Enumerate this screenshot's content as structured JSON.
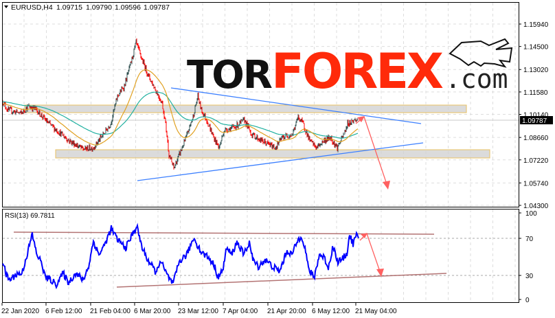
{
  "header": {
    "symbol": "EURUSD,H4",
    "open": "1.09715",
    "high": "1.09790",
    "low": "1.09596",
    "close": "1.09787"
  },
  "logo": {
    "part1": "TOR",
    "part2": "FOREX",
    "part3": ".com"
  },
  "colors": {
    "bull": "#2f4f4f",
    "bear": "#ff0000",
    "ma_fast": "#e0a020",
    "ma_slow": "#20b0a0",
    "trend": "#3b7fff",
    "rsi": "#0000ff",
    "rsi_trend": "#a05050",
    "arrow": "#ff6060",
    "logo_red": "#ff2a0a"
  },
  "chart_data": [
    {
      "type": "candlestick",
      "title": "EURUSD,H4",
      "ylim": [
        1.043,
        1.1594
      ],
      "y_ticks": [
        "1.15940",
        "1.14500",
        "1.13020",
        "1.11580",
        "1.10140",
        "1.08660",
        "1.07220",
        "1.05740",
        "1.04300"
      ],
      "current_price": "1.09787",
      "x_ticks": [
        "22 Jan 2020",
        "6 Feb 12:00",
        "21 Feb 04:00",
        "6 Mar 20:00",
        "23 Mar 12:00",
        "7 Apr 04:00",
        "21 Apr 20:00",
        "6 May 12:00",
        "21 May 04:00"
      ],
      "key_closes": [
        [
          0,
          1.1096
        ],
        [
          7,
          1.1043
        ],
        [
          27,
          1.1021
        ],
        [
          37,
          1.1065
        ],
        [
          47,
          1.1052
        ],
        [
          67,
          1.0955
        ],
        [
          97,
          1.0844
        ],
        [
          117,
          1.0791
        ],
        [
          132,
          1.08
        ],
        [
          147,
          1.0888
        ],
        [
          157,
          1.0955
        ],
        [
          167,
          1.1131
        ],
        [
          177,
          1.1197
        ],
        [
          187,
          1.1351
        ],
        [
          194,
          1.1475
        ],
        [
          202,
          1.1374
        ],
        [
          212,
          1.1263
        ],
        [
          222,
          1.1175
        ],
        [
          232,
          1.1087
        ],
        [
          237,
          1.0955
        ],
        [
          242,
          1.0756
        ],
        [
          249,
          1.0668
        ],
        [
          257,
          1.0756
        ],
        [
          267,
          1.0866
        ],
        [
          277,
          1.0999
        ],
        [
          284,
          1.1131
        ],
        [
          289,
          1.1043
        ],
        [
          297,
          1.0977
        ],
        [
          307,
          1.0866
        ],
        [
          315,
          1.08
        ],
        [
          322,
          1.091
        ],
        [
          337,
          1.0932
        ],
        [
          352,
          1.0977
        ],
        [
          362,
          1.0888
        ],
        [
          377,
          1.0844
        ],
        [
          397,
          1.08
        ],
        [
          407,
          1.0866
        ],
        [
          422,
          1.0888
        ],
        [
          430,
          1.0999
        ],
        [
          437,
          1.0955
        ],
        [
          447,
          1.0844
        ],
        [
          457,
          1.08
        ],
        [
          467,
          1.0844
        ],
        [
          477,
          1.0866
        ],
        [
          487,
          1.08
        ],
        [
          497,
          1.0888
        ],
        [
          502,
          1.0955
        ],
        [
          512,
          1.0977
        ],
        [
          517,
          1.09787
        ]
      ],
      "moving_averages": [
        "fast",
        "slow"
      ]
    },
    {
      "type": "line",
      "title": "RSI(13) 69.7811",
      "ylim": [
        0,
        100
      ],
      "y_ticks": [
        "100",
        "70",
        "30",
        "0"
      ],
      "levels": [
        70,
        30
      ],
      "key_values": [
        [
          0,
          45
        ],
        [
          5,
          29
        ],
        [
          10,
          23
        ],
        [
          20,
          30
        ],
        [
          28,
          31
        ],
        [
          36,
          55
        ],
        [
          43,
          77
        ],
        [
          49,
          55
        ],
        [
          57,
          42
        ],
        [
          62,
          26
        ],
        [
          70,
          23
        ],
        [
          78,
          18
        ],
        [
          88,
          31
        ],
        [
          96,
          20
        ],
        [
          106,
          31
        ],
        [
          117,
          23
        ],
        [
          125,
          39
        ],
        [
          132,
          69
        ],
        [
          140,
          53
        ],
        [
          148,
          64
        ],
        [
          158,
          84
        ],
        [
          166,
          72
        ],
        [
          179,
          61
        ],
        [
          195,
          87
        ],
        [
          203,
          61
        ],
        [
          211,
          47
        ],
        [
          224,
          31
        ],
        [
          229,
          47
        ],
        [
          239,
          29
        ],
        [
          248,
          18
        ],
        [
          257,
          45
        ],
        [
          268,
          53
        ],
        [
          278,
          73
        ],
        [
          289,
          56
        ],
        [
          299,
          50
        ],
        [
          307,
          42
        ],
        [
          314,
          26
        ],
        [
          320,
          34
        ],
        [
          326,
          61
        ],
        [
          333,
          53
        ],
        [
          341,
          68
        ],
        [
          351,
          53
        ],
        [
          359,
          68
        ],
        [
          364,
          47
        ],
        [
          372,
          39
        ],
        [
          382,
          47
        ],
        [
          393,
          39
        ],
        [
          403,
          33
        ],
        [
          414,
          58
        ],
        [
          421,
          53
        ],
        [
          429,
          69
        ],
        [
          435,
          76
        ],
        [
          440,
          61
        ],
        [
          445,
          37
        ],
        [
          453,
          25
        ],
        [
          461,
          53
        ],
        [
          468,
          50
        ],
        [
          474,
          37
        ],
        [
          481,
          64
        ],
        [
          487,
          45
        ],
        [
          494,
          47
        ],
        [
          501,
          55
        ],
        [
          505,
          76
        ],
        [
          510,
          66
        ],
        [
          515,
          76
        ],
        [
          518,
          69.78
        ]
      ]
    }
  ]
}
